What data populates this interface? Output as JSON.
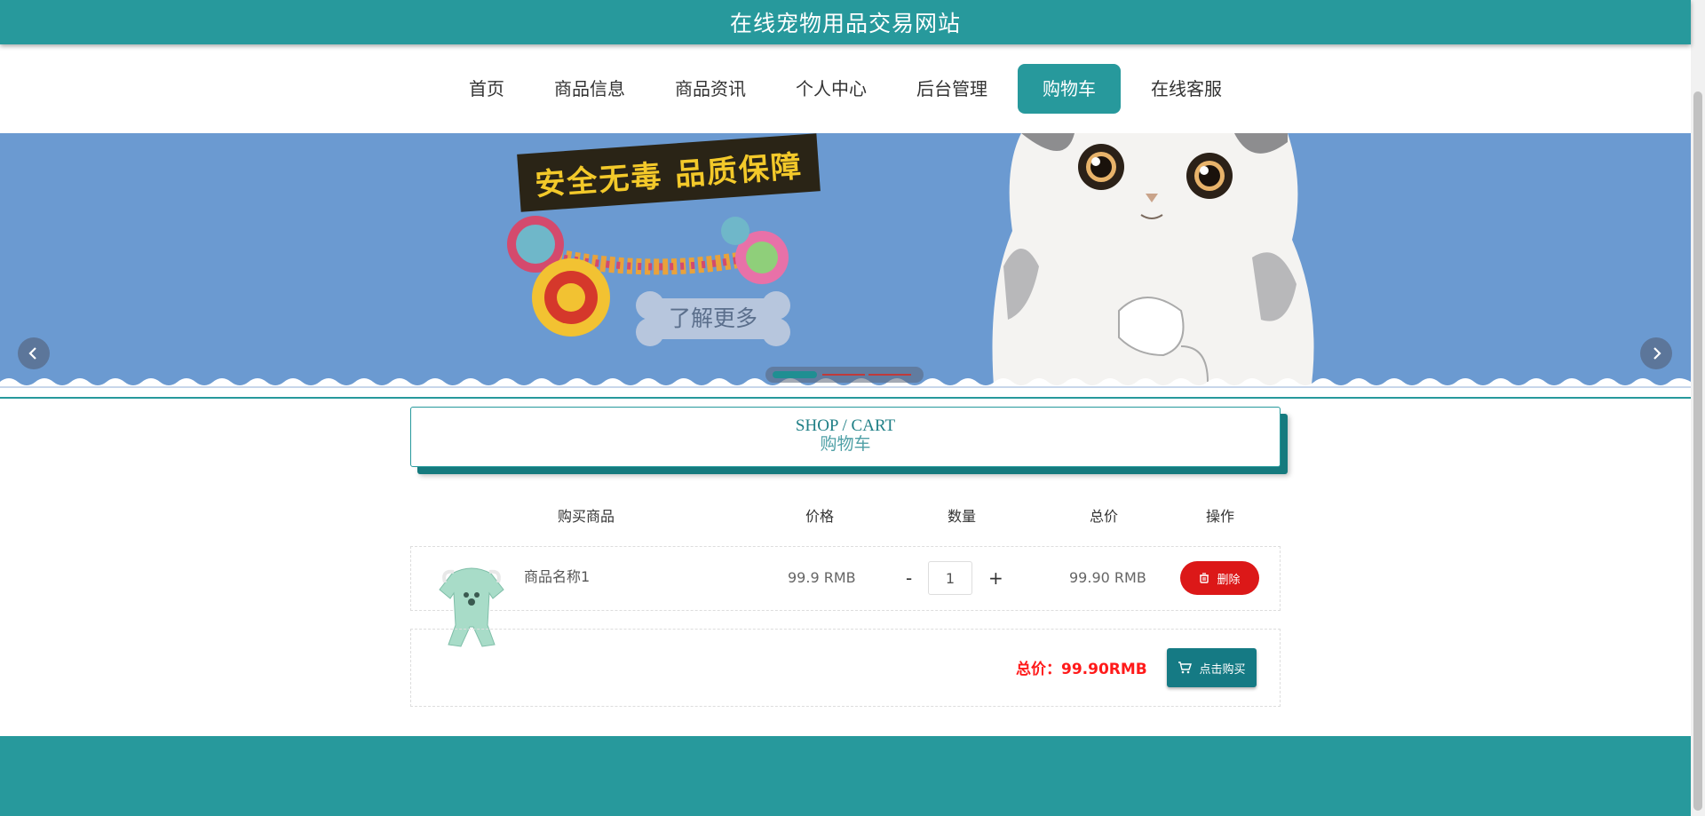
{
  "header": {
    "site_title": "在线宠物用品交易网站"
  },
  "nav": {
    "items": [
      {
        "label": "首页"
      },
      {
        "label": "商品信息"
      },
      {
        "label": "商品资讯"
      },
      {
        "label": "个人中心"
      },
      {
        "label": "后台管理"
      },
      {
        "label": "购物车",
        "active": true
      },
      {
        "label": "在线客服"
      }
    ]
  },
  "banner": {
    "slogan": "安全无毒 品质保障",
    "cta_label": "了解更多",
    "slide_count": 3,
    "active_slide": 1
  },
  "section": {
    "title_en": "SHOP / CART",
    "title_cn": "购物车"
  },
  "cart": {
    "columns": [
      "购买商品",
      "价格",
      "数量",
      "总价",
      "操作"
    ],
    "items": [
      {
        "name": "商品名称1",
        "price": "99.9 RMB",
        "quantity": "1",
        "minus_label": "-",
        "plus_label": "+",
        "subtotal": "99.90 RMB",
        "delete_label": "删除"
      }
    ],
    "total_label": "总价：",
    "total_value": "99.90RMB",
    "buy_label": "点击购买"
  },
  "colors": {
    "primary": "#27999c",
    "primary_dark": "#157a84",
    "danger": "#dc1818",
    "total_text": "#ff1a1a",
    "banner_bg": "#6b9ad1"
  },
  "icons": {
    "prev": "chevron-left-icon",
    "next": "chevron-right-icon",
    "delete": "trash-icon",
    "buy": "cart-icon"
  }
}
